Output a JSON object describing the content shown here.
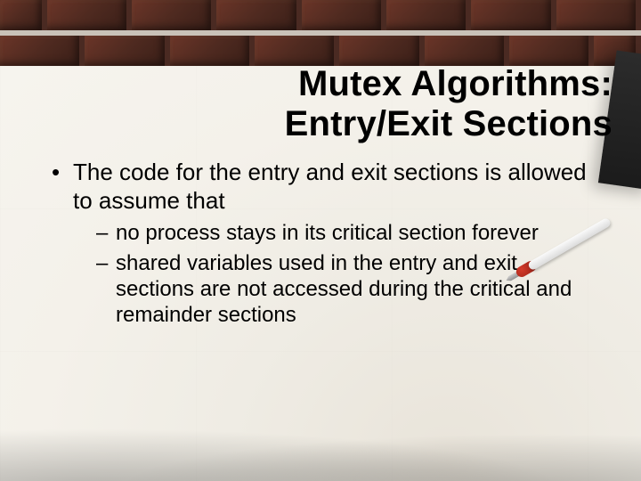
{
  "title": {
    "line1": "Mutex Algorithms:",
    "line2": "Entry/Exit Sections"
  },
  "bullets": {
    "main": "The code for the entry and exit sections is allowed to assume that",
    "sub": [
      "no process stays in its critical section forever",
      "shared variables used in the entry and exit sections are not accessed during the critical and remainder sections"
    ]
  }
}
